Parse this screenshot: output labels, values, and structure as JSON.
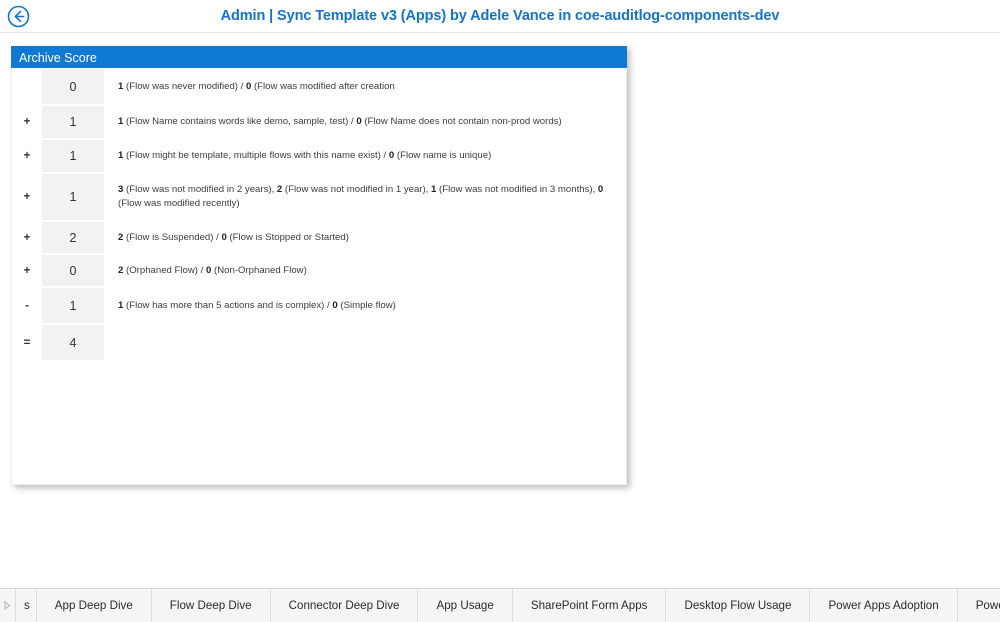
{
  "header": {
    "back_icon": "back-arrow-circle-icon",
    "title": "Admin | Sync Template v3 (Apps) by Adele Vance in coe-auditlog-components-dev",
    "title_color": "#1373cc"
  },
  "card": {
    "header_title": "Archive Score",
    "header_color": "#0f79d4",
    "rows": [
      {
        "operator": "",
        "value": "0",
        "desc_parts": [
          {
            "text": "1",
            "bold": true
          },
          {
            "text": " (Flow was never modified) / ",
            "bold": false
          },
          {
            "text": "0",
            "bold": true
          },
          {
            "text": " (Flow was modified after creation",
            "bold": false
          }
        ]
      },
      {
        "operator": "+",
        "value": "1",
        "desc_parts": [
          {
            "text": "1",
            "bold": true
          },
          {
            "text": " (Flow Name contains words like demo, sample, test) / ",
            "bold": false
          },
          {
            "text": "0",
            "bold": true
          },
          {
            "text": " (Flow Name does not contain non-prod words)",
            "bold": false
          }
        ]
      },
      {
        "operator": "+",
        "value": "1",
        "desc_parts": [
          {
            "text": "1",
            "bold": true
          },
          {
            "text": " (Flow might be template, multiple flows with this name exist) / ",
            "bold": false
          },
          {
            "text": "0",
            "bold": true
          },
          {
            "text": " (Flow name is unique)",
            "bold": false
          }
        ]
      },
      {
        "operator": "+",
        "value": "1",
        "desc_parts": [
          {
            "text": "3",
            "bold": true
          },
          {
            "text": " (Flow was not modified in 2 years), ",
            "bold": false
          },
          {
            "text": "2",
            "bold": true
          },
          {
            "text": " (Flow was not modified in 1 year), ",
            "bold": false
          },
          {
            "text": "1",
            "bold": true
          },
          {
            "text": " (Flow was not modified in 3 months), ",
            "bold": false
          },
          {
            "text": "0",
            "bold": true
          },
          {
            "text": " (Flow was modified recently)",
            "bold": false
          }
        ]
      },
      {
        "operator": "+",
        "value": "2",
        "desc_parts": [
          {
            "text": "2",
            "bold": true
          },
          {
            "text": " (Flow is Suspended) / ",
            "bold": false
          },
          {
            "text": "0",
            "bold": true
          },
          {
            "text": " (Flow is Stopped or Started)",
            "bold": false
          }
        ]
      },
      {
        "operator": "+",
        "value": "0",
        "desc_parts": [
          {
            "text": "2",
            "bold": true
          },
          {
            "text": " (Orphaned Flow) / ",
            "bold": false
          },
          {
            "text": "0",
            "bold": true
          },
          {
            "text": " (Non-Orphaned Flow)",
            "bold": false
          }
        ]
      },
      {
        "operator": "-",
        "value": "1",
        "desc_parts": [
          {
            "text": "1",
            "bold": true
          },
          {
            "text": " (Flow has more than 5 actions and is complex) / ",
            "bold": false
          },
          {
            "text": "0",
            "bold": true
          },
          {
            "text": " (Simple flow)",
            "bold": false
          }
        ]
      },
      {
        "operator": "=",
        "value": "4",
        "desc_parts": []
      }
    ]
  },
  "tabstrip": {
    "scroll_left_icon": "chevron-right-icon",
    "tabs": [
      {
        "label": "s",
        "partial": true
      },
      {
        "label": "App Deep Dive",
        "partial": false
      },
      {
        "label": "Flow Deep Dive",
        "partial": false
      },
      {
        "label": "Connector Deep Dive",
        "partial": false
      },
      {
        "label": "App Usage",
        "partial": false
      },
      {
        "label": "SharePoint Form Apps",
        "partial": false
      },
      {
        "label": "Desktop Flow Usage",
        "partial": false
      },
      {
        "label": "Power Apps Adoption",
        "partial": false
      },
      {
        "label": "Power Platfor",
        "partial": false
      }
    ]
  }
}
